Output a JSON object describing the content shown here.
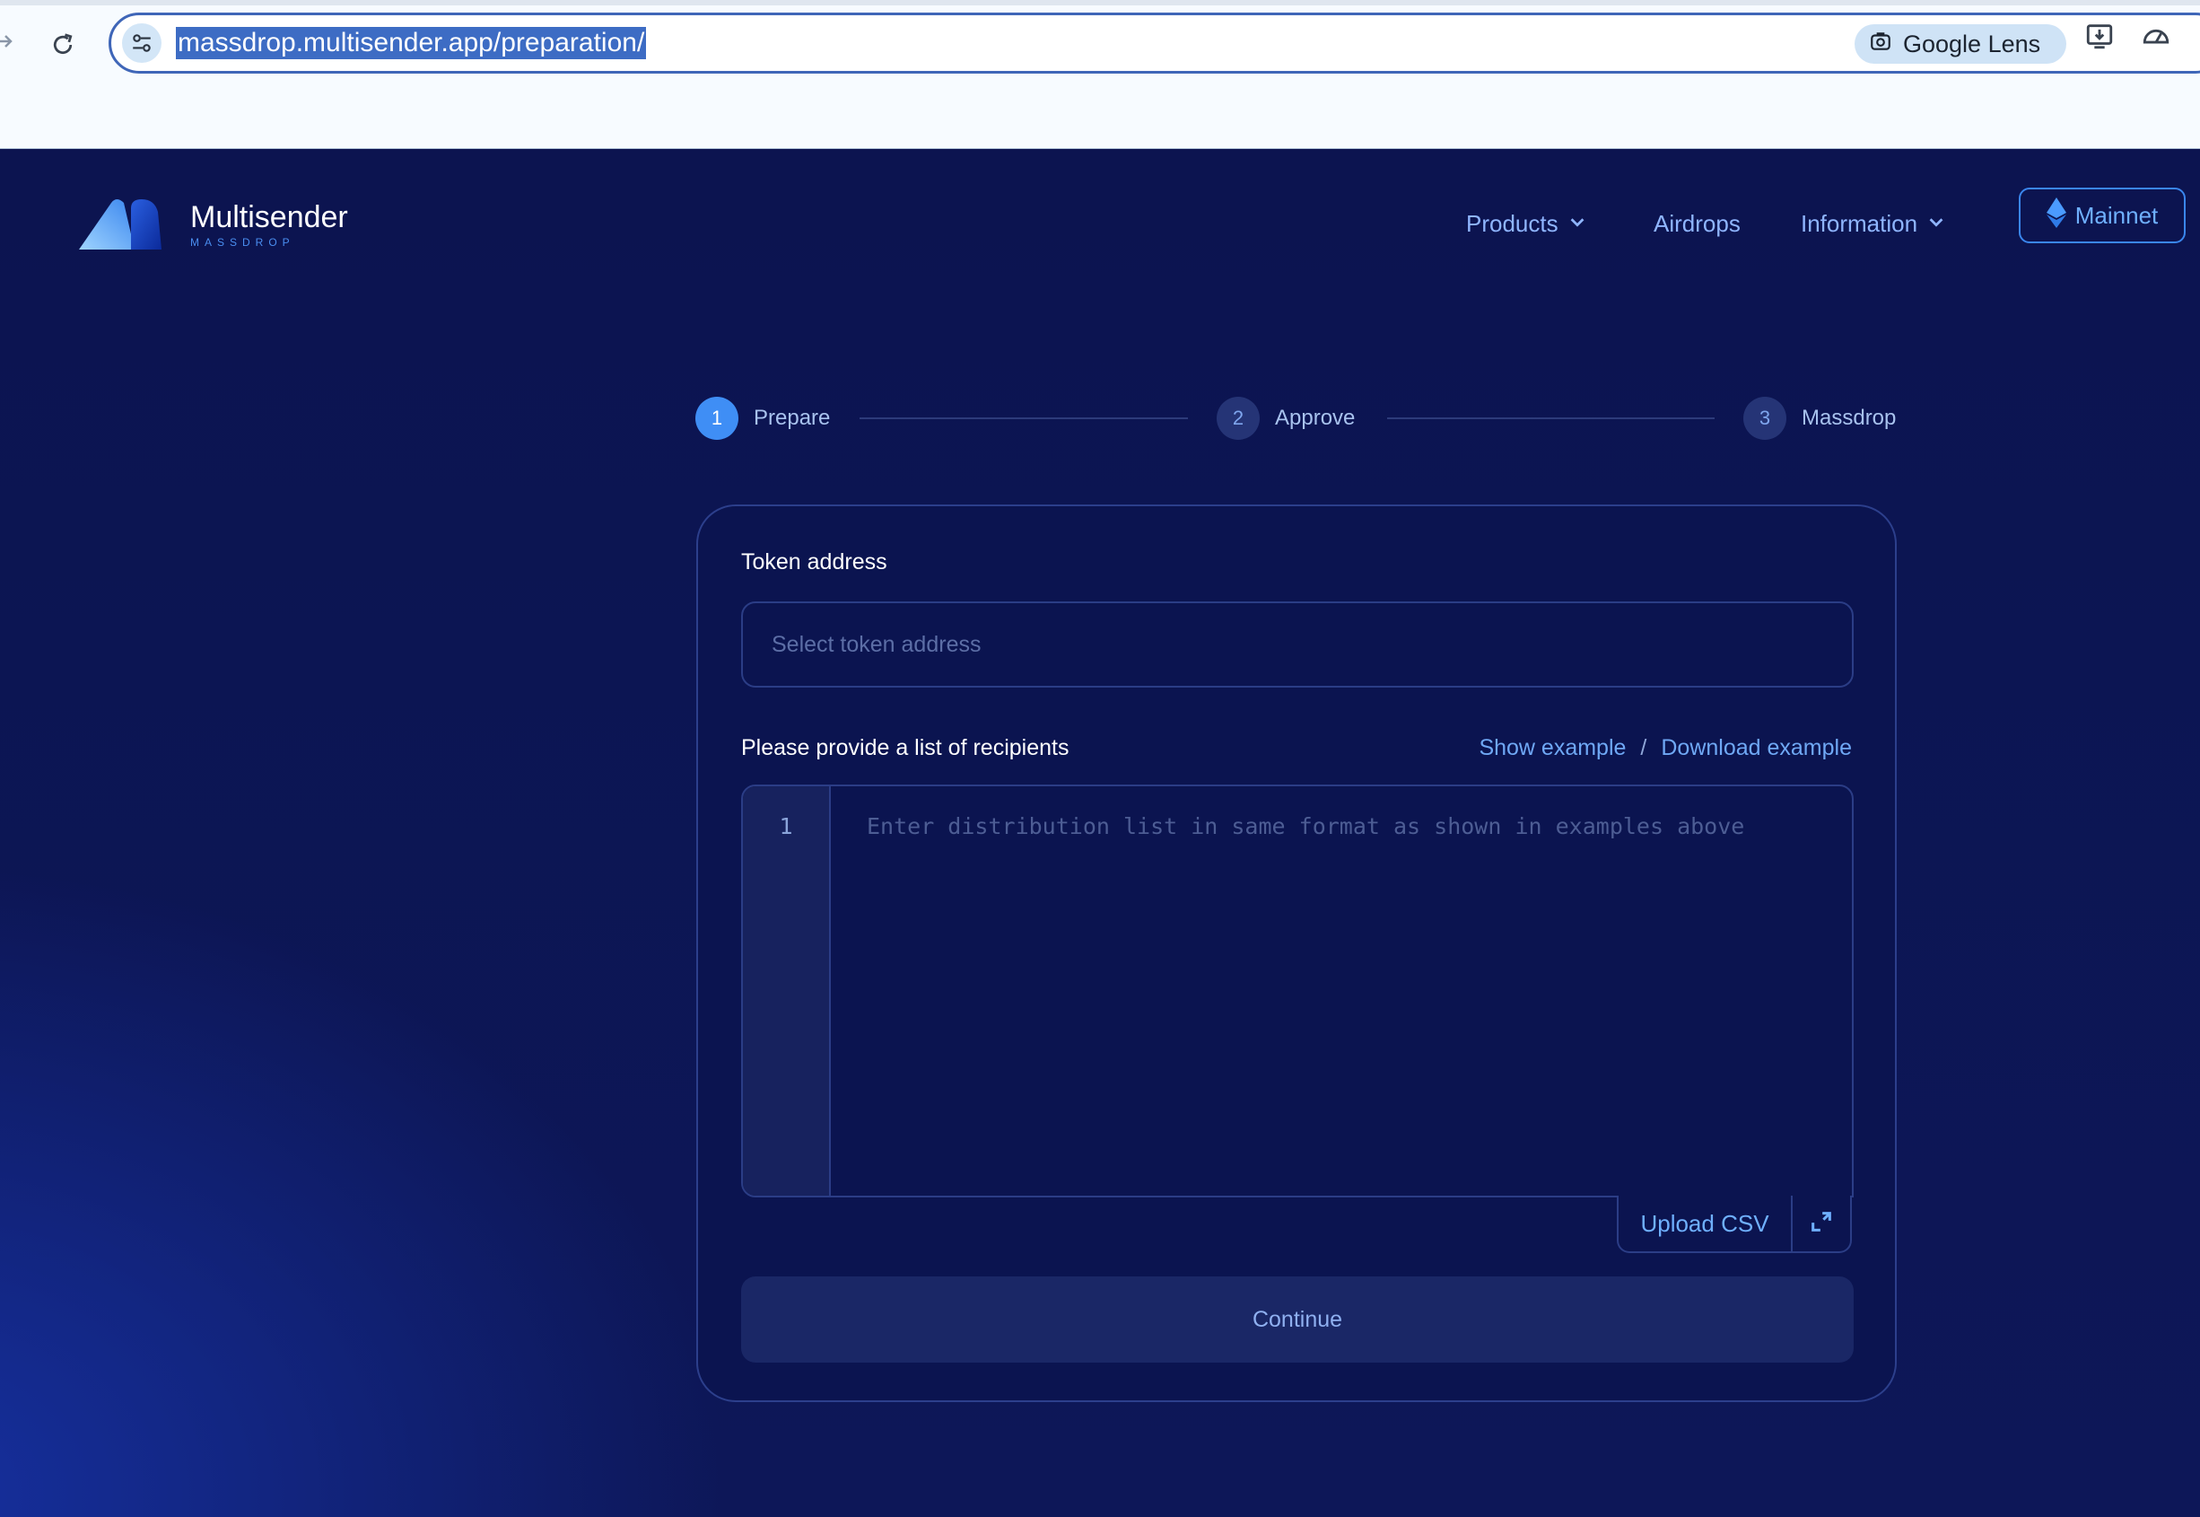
{
  "browser": {
    "url": "massdrop.multisender.app/preparation/",
    "lens_label": "Google Lens"
  },
  "brand": {
    "name": "Multisender",
    "tagline": "MASSDROP"
  },
  "nav": {
    "products": "Products",
    "airdrops": "Airdrops",
    "information": "Information",
    "network": "Mainnet"
  },
  "steps": [
    {
      "num": "1",
      "label": "Prepare",
      "state": "active"
    },
    {
      "num": "2",
      "label": "Approve",
      "state": "idle"
    },
    {
      "num": "3",
      "label": "Massdrop",
      "state": "idle"
    }
  ],
  "form": {
    "token_label": "Token address",
    "token_placeholder": "Select token address",
    "recipients_label": "Please provide a list of recipients",
    "show_example": "Show example",
    "separator": "/",
    "download_example": "Download example",
    "line_number": "1",
    "editor_placeholder": "Enter distribution list in same format as shown in examples above",
    "upload_csv": "Upload CSV",
    "continue": "Continue"
  },
  "colors": {
    "background": "#0c1450",
    "accent": "#3f8ef5",
    "link": "#6fa8f5"
  },
  "icons": [
    "reload-icon",
    "site-settings-icon",
    "google-lens-icon",
    "install-app-icon",
    "performance-icon",
    "chevron-down-icon",
    "ethereum-icon",
    "expand-icon"
  ]
}
